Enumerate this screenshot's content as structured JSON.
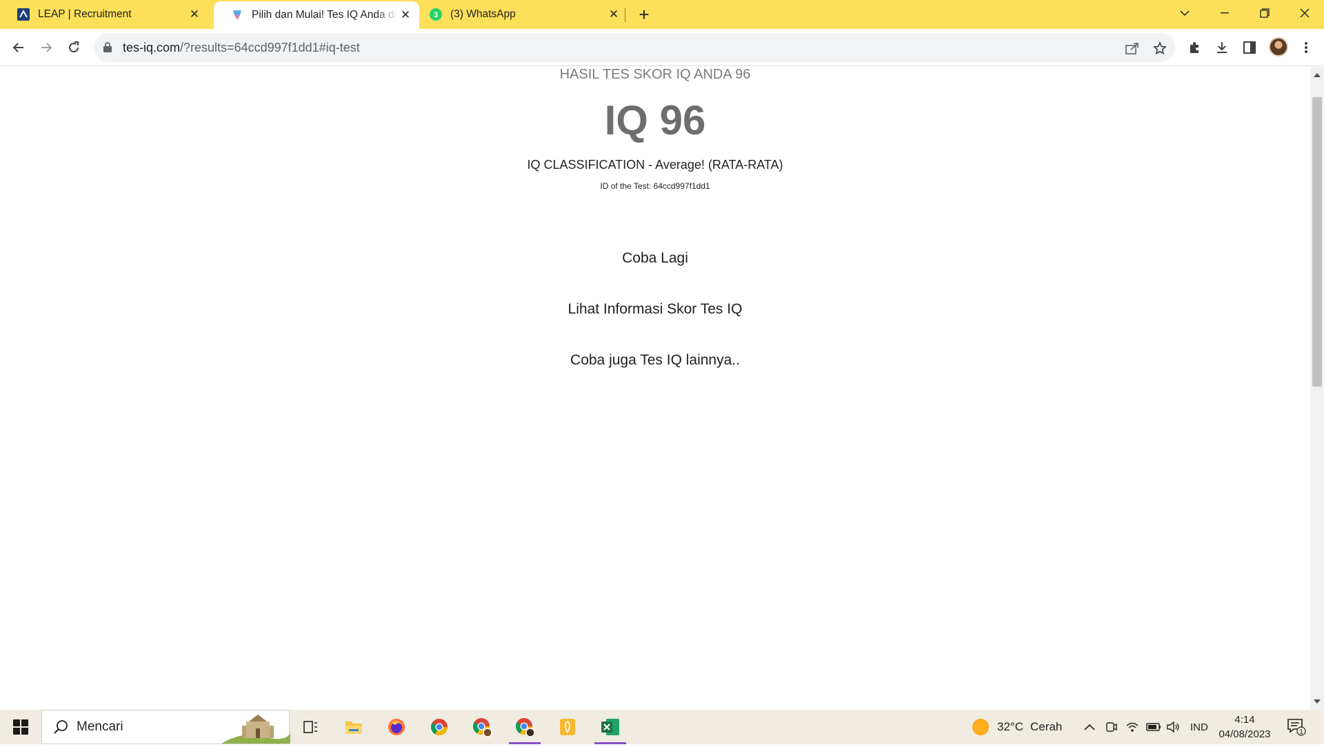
{
  "browser": {
    "tabs": [
      {
        "title": "LEAP | Recruitment",
        "favicon": "leap-icon",
        "active": false
      },
      {
        "title": "Pilih dan Mulai! Tes IQ Anda disini",
        "favicon": "tes-iq-icon",
        "active": true
      },
      {
        "title": "(3) WhatsApp",
        "favicon": "whatsapp-icon",
        "badge": "3",
        "active": false
      }
    ],
    "url_host": "tes-iq.com",
    "url_rest": "/?results=64ccd997f1dd1#iq-test"
  },
  "page": {
    "heading": "HASIL TES SKOR IQ ANDA 96",
    "iq_score": "IQ 96",
    "classification": "IQ CLASSIFICATION - Average! (RATA-RATA)",
    "test_id": "ID of the Test: 64ccd997f1dd1",
    "links": {
      "retry": "Coba Lagi",
      "info": "Lihat Informasi Skor Tes IQ",
      "more": "Coba juga Tes IQ lainnya.."
    }
  },
  "taskbar": {
    "search_placeholder": "Mencari",
    "weather_temp": "32°C",
    "weather_desc": "Cerah",
    "language": "IND",
    "time": "4:14",
    "date": "04/08/2023",
    "notifications": "1"
  },
  "colors": {
    "tabstrip": "#fde05a",
    "whatsapp": "#25d366",
    "excel": "#1d7044"
  }
}
